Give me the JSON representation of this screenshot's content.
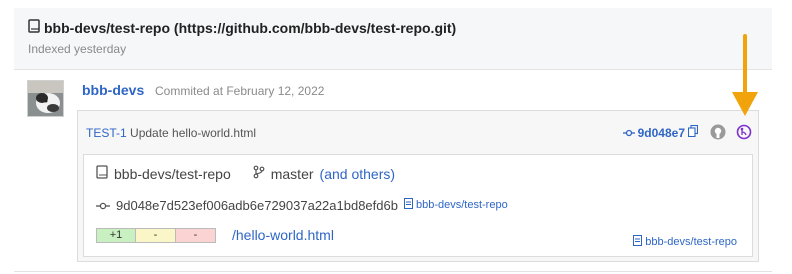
{
  "repo": {
    "title": "bbb-devs/test-repo (https://github.com/bbb-devs/test-repo.git)",
    "indexed": "Indexed yesterday"
  },
  "commit": {
    "author": "bbb-devs",
    "date": "Commited at February 12, 2022",
    "key": "TEST-1",
    "message": "Update hello-world.html",
    "sha_short": "9d048e7",
    "sha_full": "9d048e7d523ef006adb6e729037a22a1bd8efd6b",
    "sha_repo": "bbb-devs/test-repo",
    "repo": "bbb-devs/test-repo",
    "branch": "master",
    "branch_others": "(and others)"
  },
  "file": {
    "add": "+1",
    "mod": "-",
    "del": "-",
    "path": "/hello-world.html",
    "repo": "bbb-devs/test-repo"
  },
  "colors": {
    "link": "#2f66c6",
    "arrow": "#f0a30a",
    "purple_icon": "#7b2fd0"
  }
}
